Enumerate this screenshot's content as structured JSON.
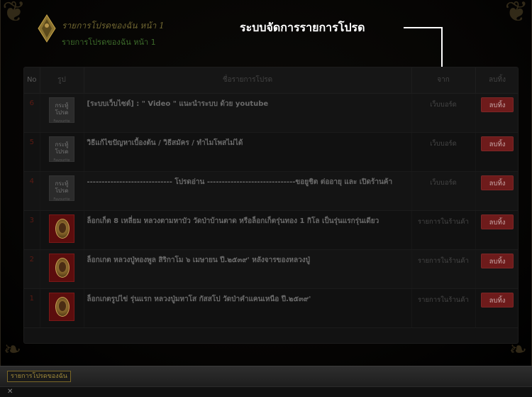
{
  "header": {
    "title": "รายการโปรดของฉัน หน้า 1",
    "subtitle": "รายการโปรดของฉัน หน้า 1"
  },
  "annotation": "ระบบจัดการรายการโปรด",
  "table": {
    "columns": [
      "No",
      "รูป",
      "ชื่อรายการโปรด",
      "จาก",
      "ลบทิ้ง"
    ],
    "rows": [
      {
        "no": "6",
        "thumb": "favorite-topic",
        "thumb_text": "กระทู้โปรด",
        "thumb_small": "Favourite Topic",
        "name": "[ระบบเว็บไซต์] : \" Video \" แนะนำระบบ ด้วย youtube",
        "source": "เว็บบอร์ด",
        "action": "ลบทิ้ง"
      },
      {
        "no": "5",
        "thumb": "favorite-topic",
        "thumb_text": "กระทู้โปรด",
        "thumb_small": "Favourite Topic",
        "name": "วิธีแก้ไขปัญหาเบื้องต้น / วิธีสมัคร / ทำไมโพสไม่ได้",
        "source": "เว็บบอร์ด",
        "action": "ลบทิ้ง"
      },
      {
        "no": "4",
        "thumb": "favorite-topic",
        "thumb_text": "กระทู้โปรด",
        "thumb_small": "Favourite Topic",
        "name": "----------------------------- โปรดอ่าน ------------------------------ขอยูชิต ต่ออายุ และ เปิดร้านค้า",
        "source": "เว็บบอร์ด",
        "action": "ลบทิ้ง"
      },
      {
        "no": "3",
        "thumb": "amulet",
        "name": "ล็อกเก็ต 8 เหลี่ยม หลวงตามหาบัว วัดป่าบ้านตาด หรือล็อกเก็ตรุ่นทอง 1 กิโล เป็นรุ่นแรกรุ่นเดียว",
        "source": "รายการในร้านค้า",
        "action": "ลบทิ้ง"
      },
      {
        "no": "2",
        "thumb": "amulet",
        "name": "ล็อกเกต หลวงปู่ทองพูล สิริกาโม ๖ เมษายน ปี.๒๕๓๙' หลังจารของหลวงปู่",
        "source": "รายการในร้านค้า",
        "action": "ลบทิ้ง"
      },
      {
        "no": "1",
        "thumb": "amulet",
        "name": "ล็อกเกตรูปไข่ รุ่นแรก หลวงปู่มหาโส กัสสโป วัดป่าคำแคนเหนือ ปี.๒๕๓๙'",
        "source": "รายการในร้านค้า",
        "action": "ลบทิ้ง"
      }
    ]
  },
  "bottom_tab": "รายการโปรดของฉัน",
  "colors": {
    "delete_button": "#6e1b1b",
    "row_number": "#5c1a12",
    "accent_gold": "#a08a3a"
  }
}
